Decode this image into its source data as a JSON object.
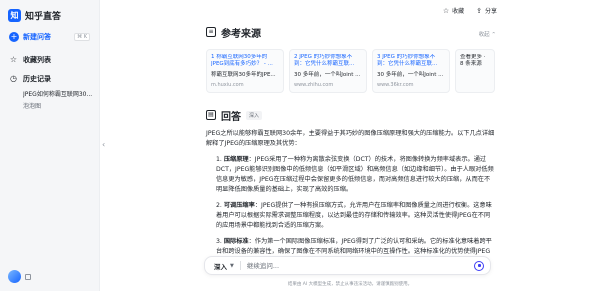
{
  "app": {
    "logo_text": "知乎直答",
    "logo_mark": "知"
  },
  "sidebar": {
    "new_question": {
      "label": "新建问答",
      "shortcut": "⌘ K"
    },
    "items": [
      {
        "label": "收藏列表",
        "icon": "star-icon"
      },
      {
        "label": "历史记录",
        "icon": "clock-icon"
      }
    ],
    "history": [
      "JPEG如何称霸互联网30...",
      "泡泡图"
    ]
  },
  "top_actions": {
    "favorite": "收藏",
    "share": "分享"
  },
  "references": {
    "title": "参考来源",
    "collapse_label": "收起",
    "cards": [
      {
        "title": "1 称霸互联网30多年的JPEG到底有多巧妙？ - ...",
        "snippet": "称霸互联网30多年的JPE...",
        "source": "m.huxiu.com"
      },
      {
        "title": "2 JPEG 的巧妙你想象不到：它凭什么称霸互联...",
        "snippet": "30 多年前，一个叫Joint ...",
        "source": "www.zhihu.com"
      },
      {
        "title": "3 JPEG 的巧妙你想象不到：它凭什么称霸互联...",
        "snippet": "30 多年前，一个叫Joint ...",
        "source": "www.36kr.com"
      },
      {
        "title": "查看更多 · 8 条来源",
        "snippet": "",
        "source": ""
      }
    ]
  },
  "answer": {
    "title": "回答",
    "badge": "深入",
    "intro": "JPEG之所以能够称霸互联网30余年，主要得益于其巧妙的图像压缩原理和强大的压缩能力。以下几点详细解释了JPEG的压缩原理及其优势：",
    "points": [
      {
        "n": "1.",
        "head": "压缩原理",
        "body": "：JPEG采用了一种称为离散余弦变换（DCT）的技术，将图像转换为频率域表示。通过DCT，JPEG能够识别图像中的低频信息（如平滑区域）和高频信息（如边缘和细节）。由于人眼对低频信息更为敏感，JPEG在压缩过程中会保留更多的低频信息，而对高频信息进行较大的压缩，从而在不明显降低图像质量的基础上，实现了高效的压缩。"
      },
      {
        "n": "2.",
        "head": "可调压缩率",
        "body": "：JPEG提供了一种有损压缩方式，允许用户在压缩率和图像质量之间进行权衡。这意味着用户可以根据实际需求调整压缩程度，以达到最佳的存储和传输效率。这种灵活性使得JPEG在不同的应用场景中都能找到合适的压缩方案。"
      },
      {
        "n": "3.",
        "head": "国际标准",
        "body": "：作为第一个国际图像压缩标准，JPEG得到了广泛的认可和采纳。它的标准化意味着跨平台和跨设备的兼容性，确保了图像在不同系统和网络环境中的互操作性。这种标准化的优势使得JPEG成为了互联网上最常用的图像格式之一。"
      }
    ]
  },
  "input": {
    "mode": "深入",
    "placeholder": "继续追问..."
  },
  "disclaimer": "结果由 AI 大模型生成，禁止从事违法活动，请谨慎甄别使用。"
}
